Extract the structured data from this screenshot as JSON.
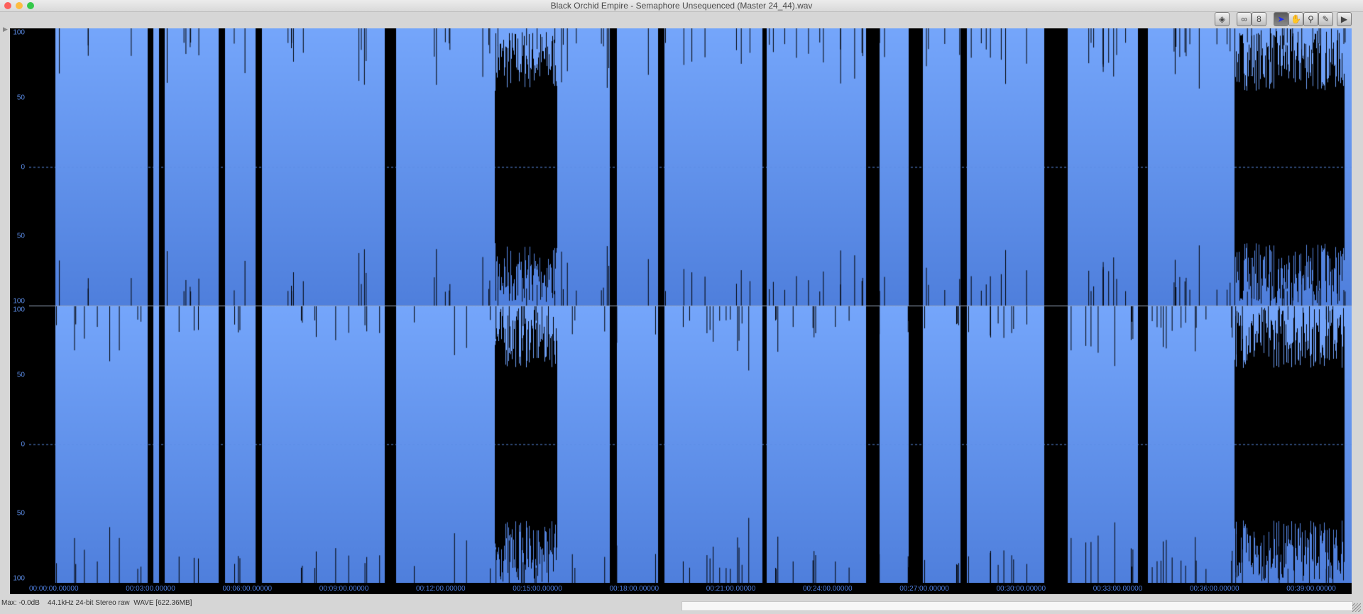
{
  "window": {
    "title": "Black Orchid Empire - Semaphore Unsequenced (Master 24_44).wav"
  },
  "toolbar": {
    "buttons": [
      {
        "name": "loop-toggle",
        "icon": "diamond-arrows-icon",
        "glyph": "◈"
      },
      {
        "name": "link-channels",
        "icon": "linked-channels-icon",
        "glyph": "∞"
      },
      {
        "name": "stacked-channels",
        "icon": "stacked-channels-icon",
        "glyph": "8"
      },
      {
        "name": "select-tool",
        "icon": "arrow-cursor-icon",
        "glyph": "➤",
        "active": true
      },
      {
        "name": "hand-tool",
        "icon": "hand-icon",
        "glyph": "✋"
      },
      {
        "name": "zoom-tool",
        "icon": "magnifier-icon",
        "glyph": "⚲"
      },
      {
        "name": "pencil-tool",
        "icon": "pencil-icon",
        "glyph": "✎"
      },
      {
        "name": "play-button",
        "icon": "play-icon",
        "glyph": "▶"
      }
    ]
  },
  "ruler": {
    "labels": [
      "100",
      "50",
      "0",
      "50",
      "100"
    ]
  },
  "timeline": {
    "labels": [
      "00:00:00.00000",
      "00:03:00.00000",
      "00:06:00.00000",
      "00:09:00.00000",
      "00:12:00.00000",
      "00:15:00.00000",
      "00:18:00.00000",
      "00:21:00.00000",
      "00:24:00.00000",
      "00:27:00.00000",
      "00:30:00.00000",
      "00:33:00.00000",
      "00:36:00.00000",
      "00:39:00.00000"
    ]
  },
  "waveform": {
    "duration_minutes": 40.8,
    "channels": 2,
    "loud_sections_minutes": [
      [
        0,
        0.8
      ],
      [
        3.69,
        3.85
      ],
      [
        4.04,
        4.2
      ],
      [
        5.88,
        6.07
      ],
      [
        7.04,
        7.22
      ],
      [
        11.05,
        11.38
      ],
      [
        14.45,
        16.36
      ],
      [
        18.03,
        18.22
      ],
      [
        19.51,
        19.7
      ],
      [
        22.75,
        22.86
      ],
      [
        25.96,
        26.36
      ],
      [
        27.3,
        27.7
      ],
      [
        28.89,
        29.08
      ],
      [
        31.5,
        32.2
      ],
      [
        34.4,
        34.7
      ],
      [
        37.4,
        40.8
      ]
    ],
    "colors": {
      "background_top": "#75a6fb",
      "background_bottom": "#4f7fdc",
      "signal": "#000000",
      "zero_line": "#5b8ce6"
    }
  },
  "status": {
    "text": "Max: -0.0dB    44.1kHz 24-bit Stereo raw  WAVE [622.36MB]"
  }
}
